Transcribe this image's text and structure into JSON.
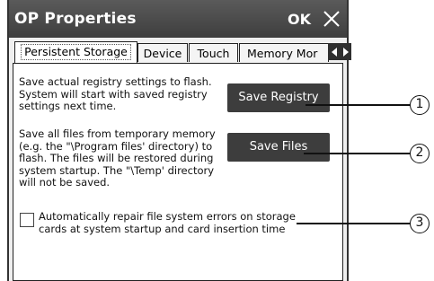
{
  "window": {
    "title": "OP Properties",
    "ok_label": "OK",
    "close_icon": "close-icon"
  },
  "tabs": [
    {
      "label": "Persistent Storage",
      "active": true
    },
    {
      "label": "Device",
      "active": false
    },
    {
      "label": "Touch",
      "active": false
    },
    {
      "label": "Memory Mor",
      "active": false
    }
  ],
  "tab_scroll": {
    "left_icon": "arrow-left-icon",
    "right_icon": "arrow-right-icon"
  },
  "registry": {
    "description_lines": [
      "Save actual registry settings to flash.",
      "System will start with saved registry",
      "settings next time."
    ],
    "button_label": "Save Registry"
  },
  "files": {
    "description_lines": [
      "Save all files from temporary memory",
      "(e.g. the \"\\Program files' directory) to",
      "flash. The files will be restored during",
      "system startup. The \"\\Temp' directory",
      "will not be saved."
    ],
    "button_label": "Save Files"
  },
  "repair": {
    "checked": false,
    "label_lines": [
      "Automatically repair file system errors on storage",
      "cards at system startup and card insertion time"
    ]
  },
  "callouts": [
    "1",
    "2",
    "3"
  ]
}
